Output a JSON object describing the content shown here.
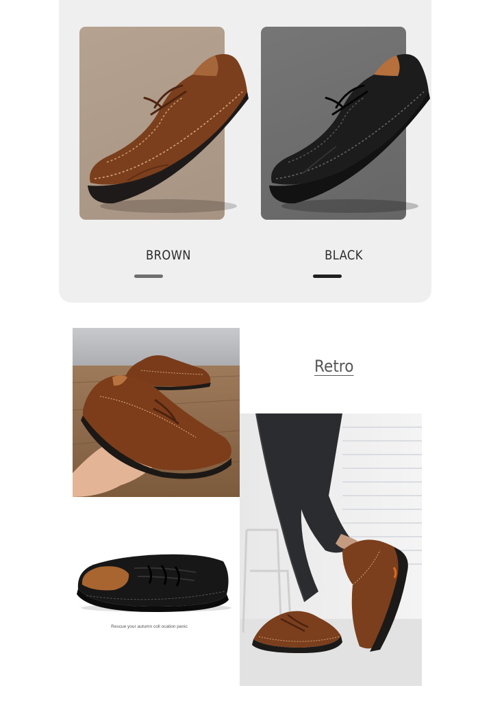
{
  "colors": [
    {
      "name": "BROWN",
      "swatch": "#7a3e1c"
    },
    {
      "name": "BLACK",
      "swatch": "#1a1a1a"
    }
  ],
  "gallery": {
    "heading": "Retro",
    "caption": "Rescue your autumn coll ocation panic"
  }
}
